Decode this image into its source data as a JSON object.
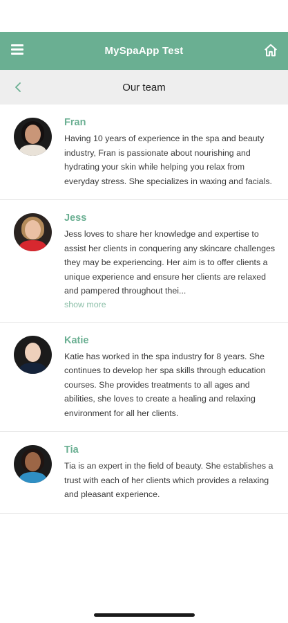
{
  "app_bar": {
    "title": "MySpaApp Test",
    "menu_icon": "hamburger-menu-icon",
    "home_icon": "home-icon"
  },
  "sub_bar": {
    "title": "Our team",
    "back_icon": "chevron-left-icon"
  },
  "colors": {
    "accent": "#6aaf92",
    "subheader": "#eeeeee",
    "link": "#8cbfa8"
  },
  "members": [
    {
      "name": "Fran",
      "bio": "Having 10 years of experience in the spa and beauty industry, Fran is passionate about nourishing and hydrating your skin while helping you relax from everyday stress. She specializes in waxing and facials."
    },
    {
      "name": "Jess",
      "bio": "Jess loves to share her knowledge and expertise to assist her clients in conquering any skincare challenges they may be experiencing. Her aim is to offer clients a unique experience and ensure her clients are relaxed and pampered throughout thei...",
      "more_label": "show more"
    },
    {
      "name": "Katie",
      "bio": "Katie has worked in the spa industry for 8 years. She continues to develop her spa skills through education courses. She provides treatments to all ages and abilities, she loves to create a healing and relaxing environment for all her clients."
    },
    {
      "name": "Tia",
      "bio": "Tia is an expert in the field of beauty. She establishes a trust with each of her clients which provides a relaxing and pleasant experience."
    }
  ]
}
